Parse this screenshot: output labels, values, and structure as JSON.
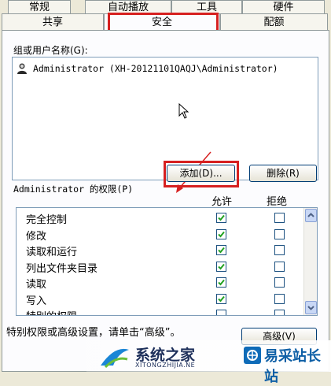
{
  "tabs_back": [
    "常规",
    "自动播放",
    "工具",
    "硬件"
  ],
  "tabs_front": [
    "共享",
    "安全",
    "配额"
  ],
  "group_label": "组或用户名称(G):",
  "user_entry": "Administrator (XH-20121101QAQJ\\Administrator)",
  "add_button": "添加(D)...",
  "remove_button": "删除(R)",
  "perm_label": "Administrator 的权限(P)",
  "allow_header": "允许",
  "deny_header": "拒绝",
  "permissions": [
    {
      "name": "完全控制",
      "allow": true,
      "deny": false
    },
    {
      "name": "修改",
      "allow": true,
      "deny": false
    },
    {
      "name": "读取和运行",
      "allow": true,
      "deny": false
    },
    {
      "name": "列出文件夹目录",
      "allow": true,
      "deny": false
    },
    {
      "name": "读取",
      "allow": true,
      "deny": false
    },
    {
      "name": "写入",
      "allow": true,
      "deny": false
    },
    {
      "name": "特别的权限",
      "allow": false,
      "deny": false
    }
  ],
  "advanced_note": "特别权限或高级设置，请单击“高级”。",
  "advanced_button": "高级(V)",
  "watermark_left": "系统之家",
  "watermark_left_sub": "XITONGZHIJIA.NE",
  "watermark_right": "易采站长站",
  "colors": {
    "highlight_red": "#d62020",
    "check_green": "#21a121"
  }
}
